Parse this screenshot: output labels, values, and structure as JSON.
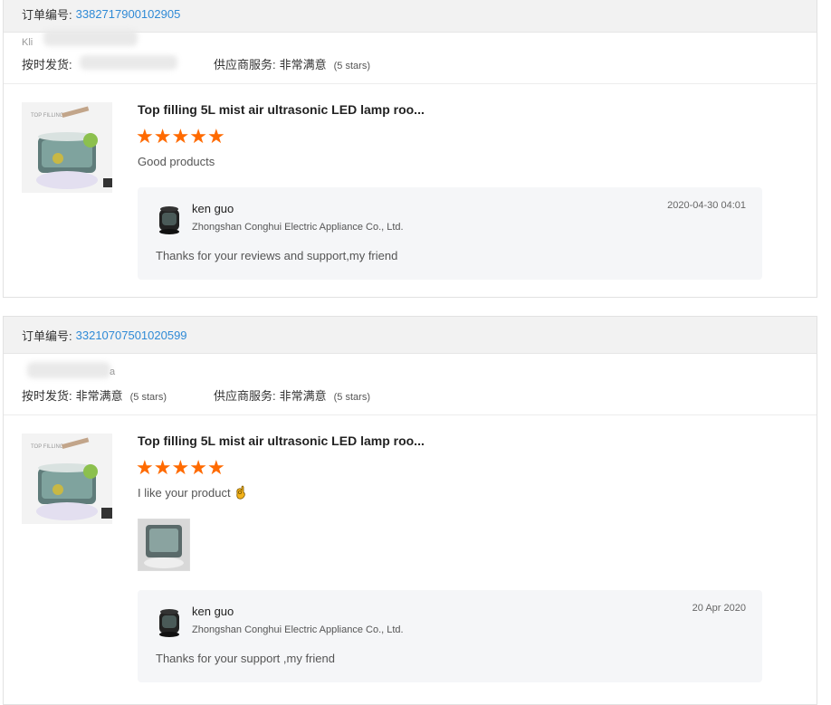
{
  "orders": [
    {
      "order_label": "订单编号:",
      "order_number": "3382717900102905",
      "buyer_partial": "Kli",
      "ontime_label": "按时发货:",
      "supplier_label": "供应商服务:",
      "supplier_value": "非常满意",
      "supplier_stars": "(5 stars)",
      "product_title": "Top filling 5L mist air ultrasonic LED lamp roo...",
      "rating": 5,
      "comment": "Good products",
      "reply": {
        "name": "ken guo",
        "company": "Zhongshan Conghui Electric Appliance Co., Ltd.",
        "date": "2020-04-30 04:01",
        "text": "Thanks for your reviews and support,my friend"
      }
    },
    {
      "order_label": "订单编号:",
      "order_number": "33210707501020599",
      "buyer_partial": "a",
      "ontime_label": "按时发货:",
      "ontime_value": "非常满意",
      "ontime_stars": "(5 stars)",
      "supplier_label": "供应商服务:",
      "supplier_value": "非常满意",
      "supplier_stars": "(5 stars)",
      "product_title": "Top filling 5L mist air ultrasonic LED lamp roo...",
      "rating": 5,
      "comment": "I like your product",
      "reply": {
        "name": "ken guo",
        "company": "Zhongshan Conghui Electric Appliance Co., Ltd.",
        "date": "20 Apr 2020",
        "text": "Thanks for your support ,my friend"
      }
    }
  ],
  "icons": {
    "star": "star-icon",
    "ok_hand": "ok-hand-emoji-icon",
    "avatar": "humidifier-avatar-icon"
  },
  "colors": {
    "star": "#ff6a00",
    "order_number": "#2f8ad6",
    "header_bg": "#f2f2f2",
    "reply_bg": "#f5f6f8"
  }
}
